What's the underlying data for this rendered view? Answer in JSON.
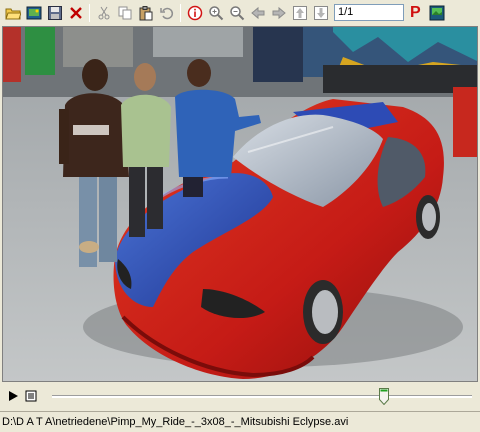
{
  "toolbar": {
    "icons": [
      "open-folder-icon",
      "open-image-icon",
      "save-icon",
      "close-icon",
      "cut-icon",
      "copy-icon",
      "paste-icon",
      "undo-icon",
      "info-icon",
      "zoom-in-icon",
      "zoom-out-icon",
      "back-arrow-icon",
      "forward-arrow-icon",
      "page-up-icon",
      "page-down-icon",
      "p-icon",
      "slideshow-icon"
    ],
    "page_field": "1/1",
    "p_label": "P"
  },
  "player": {
    "seek_position": 0.79
  },
  "status": {
    "path": "D:\\D A T A\\netriedene\\Pimp_My_Ride_-_3x08_-_Mitsubishi Eclypse.avi"
  },
  "colors": {
    "car_red": "#c8201a",
    "car_blue": "#2f4fb8",
    "close_red": "#c00000",
    "info_red": "#d21414"
  }
}
